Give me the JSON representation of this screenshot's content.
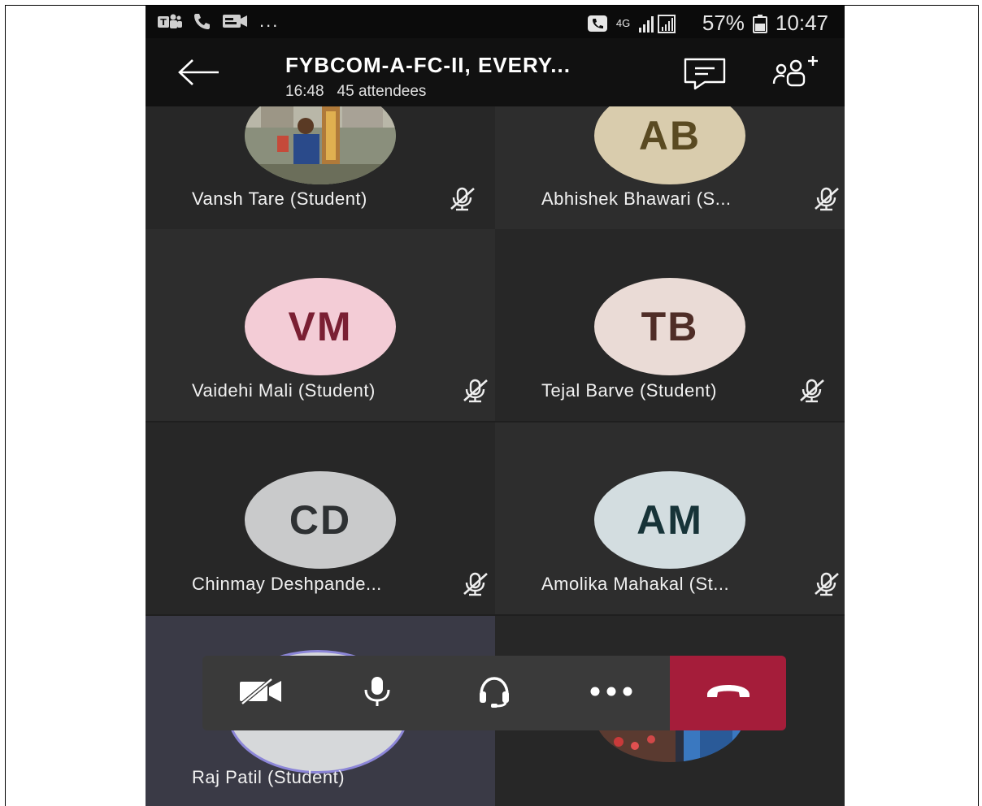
{
  "statusbar": {
    "left_icons": [
      "teams-icon",
      "phone-icon",
      "video-icon"
    ],
    "more": "...",
    "network": "4G",
    "battery_percent": "57%",
    "time": "10:47"
  },
  "header": {
    "title": "FYBCOM-A-FC-II, EVERY...",
    "duration": "16:48",
    "attendees": "45 attendees"
  },
  "participants": [
    {
      "name": "Vansh Tare (Student)",
      "initials": "",
      "avatar_type": "photo",
      "muted": true
    },
    {
      "name": "Abhishek Bhawari (S...",
      "initials": "AB",
      "avatar_bg": "#d9ccad",
      "initials_color": "#5a4a22",
      "muted": true
    },
    {
      "name": "Vaidehi Mali (Student)",
      "initials": "VM",
      "avatar_bg": "#f3ccd6",
      "initials_color": "#7a1f33",
      "muted": true
    },
    {
      "name": "Tejal Barve (Student)",
      "initials": "TB",
      "avatar_bg": "#eadbd6",
      "initials_color": "#4f2d27",
      "muted": true
    },
    {
      "name": "Chinmay Deshpande...",
      "initials": "CD",
      "avatar_bg": "#c9cacb",
      "initials_color": "#2e3133",
      "muted": true
    },
    {
      "name": "Amolika Mahakal (St...",
      "initials": "AM",
      "avatar_bg": "#d3dde0",
      "initials_color": "#173338",
      "muted": true
    },
    {
      "name": "Raj Patil (Student)",
      "initials": "",
      "avatar_type": "blank",
      "muted": false
    },
    {
      "name": "",
      "initials": "",
      "avatar_type": "photo",
      "muted": false
    }
  ],
  "controls": {
    "items": [
      "camera-off",
      "microphone",
      "audio-headset",
      "more-options",
      "hang-up"
    ],
    "hangup_color": "#a51d3a"
  }
}
